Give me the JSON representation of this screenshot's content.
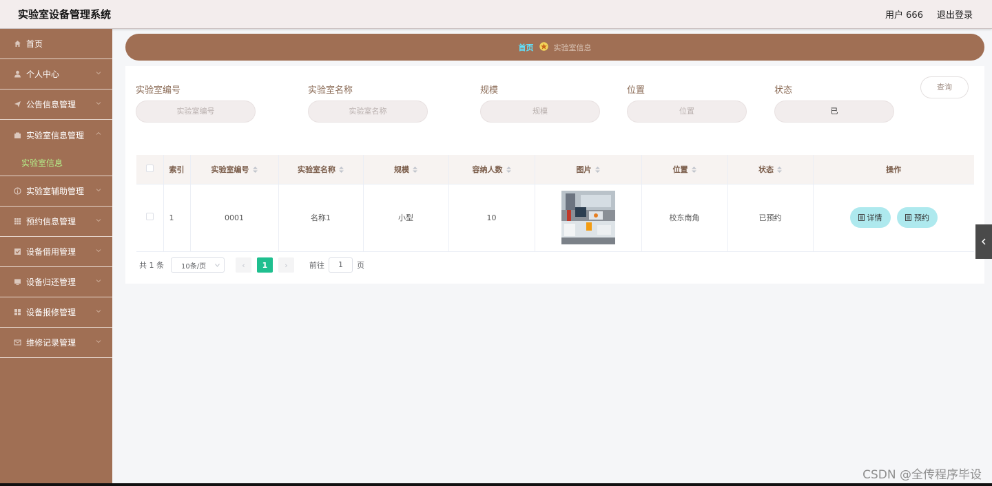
{
  "header": {
    "title": "实验室设备管理系统",
    "user": "用户 666",
    "logout": "退出登录"
  },
  "sidebar": {
    "items": [
      {
        "label": "首页",
        "icon": "home-icon"
      },
      {
        "label": "个人中心",
        "icon": "user-icon"
      },
      {
        "label": "公告信息管理",
        "icon": "send-icon"
      },
      {
        "label": "实验室信息管理",
        "icon": "folder-icon",
        "sub": [
          "实验室信息"
        ]
      },
      {
        "label": "实验室辅助管理",
        "icon": "info-icon"
      },
      {
        "label": "预约信息管理",
        "icon": "grid-icon"
      },
      {
        "label": "设备借用管理",
        "icon": "check-square-icon"
      },
      {
        "label": "设备归还管理",
        "icon": "monitor-icon"
      },
      {
        "label": "设备报修管理",
        "icon": "apps-icon"
      },
      {
        "label": "维修记录管理",
        "icon": "mail-icon"
      }
    ]
  },
  "breadcrumb": {
    "home": "首页",
    "current": "实验室信息"
  },
  "search": {
    "fields": [
      {
        "label": "实验室编号",
        "placeholder": "实验室编号",
        "value": ""
      },
      {
        "label": "实验室名称",
        "placeholder": "实验室名称",
        "value": ""
      },
      {
        "label": "规模",
        "placeholder": "规模",
        "value": ""
      },
      {
        "label": "位置",
        "placeholder": "位置",
        "value": ""
      },
      {
        "label": "状态",
        "placeholder": "",
        "value": "已"
      }
    ],
    "query_label": "查询"
  },
  "table": {
    "headers": [
      "索引",
      "实验室编号",
      "实验室名称",
      "规模",
      "容纳人数",
      "图片",
      "位置",
      "状态",
      "操作"
    ],
    "rows": [
      {
        "index": "1",
        "code": "0001",
        "name": "名称1",
        "scale": "小型",
        "capacity": "10",
        "location": "校东南角",
        "status": "已预约"
      }
    ],
    "actions": {
      "detail": "详情",
      "reserve": "预约"
    }
  },
  "pagination": {
    "total": "共 1 条",
    "page_size": "10条/页",
    "current_page": "1",
    "goto_prefix": "前往",
    "goto_value": "1",
    "goto_suffix": "页"
  },
  "watermark": "CSDN @全传程序毕设",
  "colors": {
    "sidebar": "#a06f54",
    "header": "#f3eded",
    "accent": "#1fbf8f",
    "action_button": "#aee9ee"
  }
}
